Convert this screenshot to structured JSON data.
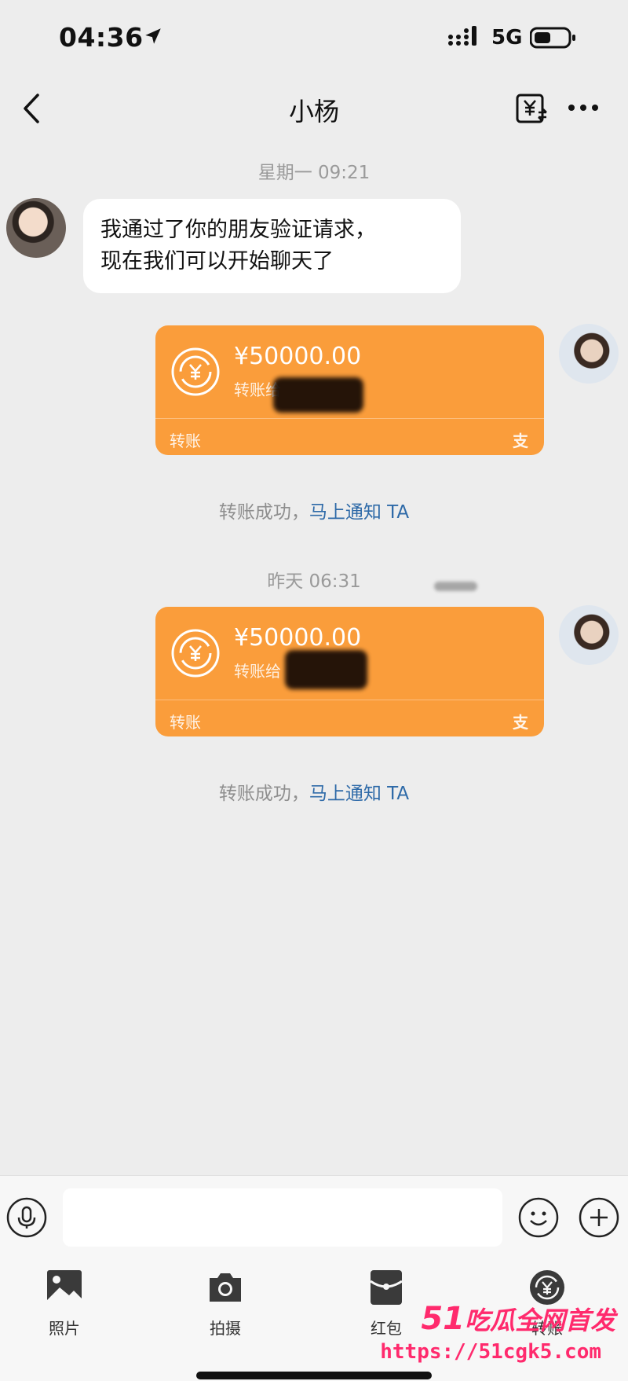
{
  "status_bar": {
    "time": "04:36",
    "network": "5G"
  },
  "nav": {
    "title": "小杨"
  },
  "messages": [
    {
      "type": "timestamp",
      "text": "星期一 09:21"
    },
    {
      "type": "text",
      "side": "left",
      "text_line1": "我通过了你的朋友验证请求，",
      "text_line2": "现在我们可以开始聊天了"
    },
    {
      "type": "transfer",
      "side": "right",
      "amount": "¥50000.00",
      "note": "转账给",
      "label": "转账"
    },
    {
      "type": "system",
      "text": "转账成功，",
      "link": "马上通知 TA"
    },
    {
      "type": "timestamp",
      "text": "昨天 06:31"
    },
    {
      "type": "transfer",
      "side": "right",
      "amount": "¥50000.00",
      "note": "转账给",
      "label": "转账"
    },
    {
      "type": "system",
      "text": "转账成功，",
      "link": "马上通知 TA"
    }
  ],
  "toolbar": {
    "items": [
      {
        "label": "照片",
        "icon": "photo-icon"
      },
      {
        "label": "拍摄",
        "icon": "camera-icon"
      },
      {
        "label": "红包",
        "icon": "red-packet-icon"
      },
      {
        "label": "转账",
        "icon": "transfer-icon"
      }
    ]
  },
  "watermark": {
    "line1_num": "51",
    "line1_text": "吃瓜全网首发",
    "line2": "https://51cgk5.com"
  },
  "colors": {
    "transfer_card": "#fa9d3b",
    "link": "#2e6aa8",
    "background": "#ededed"
  }
}
